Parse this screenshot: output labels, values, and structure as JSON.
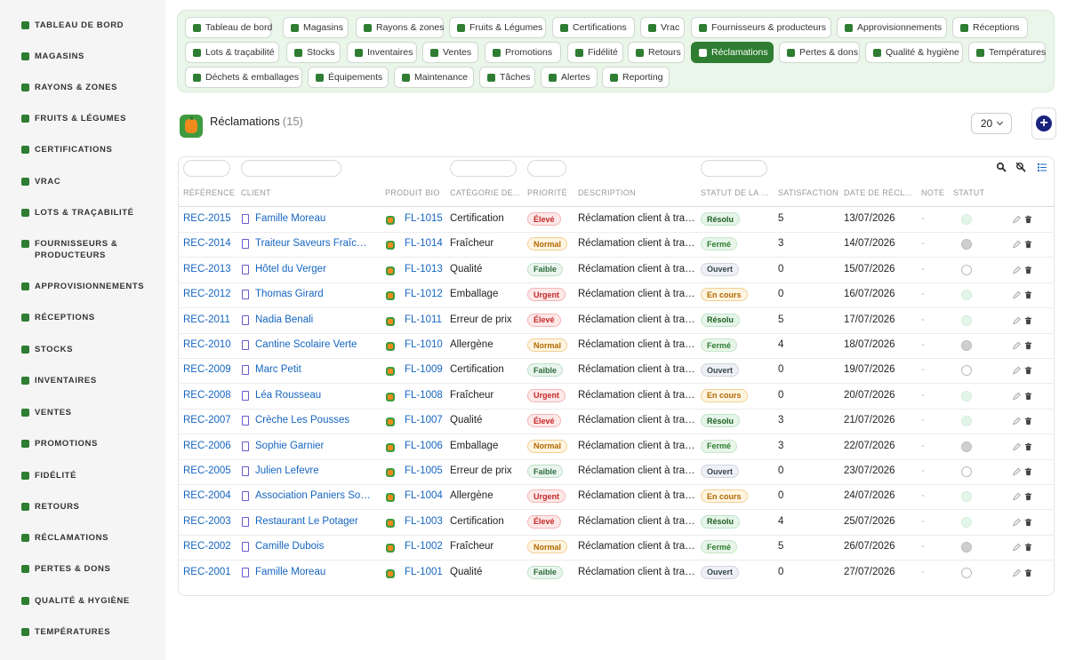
{
  "sidebar": {
    "items": [
      {
        "label": "Tableau de bord",
        "icon": "seedling-icon"
      },
      {
        "label": "Magasins",
        "icon": "store-icon"
      },
      {
        "label": "Rayons & zones",
        "icon": "grid-icon"
      },
      {
        "label": "Fruits & Légumes",
        "icon": "leaf-icon"
      },
      {
        "label": "Certifications",
        "icon": "certificate-icon"
      },
      {
        "label": "Vrac",
        "icon": "boxes-icon"
      },
      {
        "label": "Lots & traçabilité",
        "icon": "barcode-icon"
      },
      {
        "label": "Fournisseurs & producteurs",
        "icon": "truck-icon"
      },
      {
        "label": "Approvisionnements",
        "icon": "supply-icon"
      },
      {
        "label": "Réceptions",
        "icon": "truck-loading-icon"
      },
      {
        "label": "Stocks",
        "icon": "warehouse-icon"
      },
      {
        "label": "Inventaires",
        "icon": "clipboard-check-icon"
      },
      {
        "label": "Ventes",
        "icon": "cash-register-icon"
      },
      {
        "label": "Promotions",
        "icon": "tag-icon"
      },
      {
        "label": "Fidélité",
        "icon": "award-icon"
      },
      {
        "label": "Retours",
        "icon": "undo-icon"
      },
      {
        "label": "Réclamations",
        "icon": "comment-icon"
      },
      {
        "label": "Pertes & dons",
        "icon": "trash-icon"
      },
      {
        "label": "Qualité & hygiène",
        "icon": "clipboard-icon"
      },
      {
        "label": "Températures",
        "icon": "thermometer-icon"
      }
    ]
  },
  "nav": {
    "chips": [
      {
        "label": "Tableau de bord",
        "icon": "seedling-icon"
      },
      {
        "label": "Magasins",
        "icon": "store-icon"
      },
      {
        "label": "Rayons & zones",
        "icon": "grid-icon"
      },
      {
        "label": "Fruits & Légumes",
        "icon": "leaf-icon"
      },
      {
        "label": "Certifications",
        "icon": "certificate-icon"
      },
      {
        "label": "Vrac",
        "icon": "boxes-icon"
      },
      {
        "label": "Fournisseurs & producteurs",
        "icon": "truck-icon"
      },
      {
        "label": "Approvisionnements",
        "icon": "supply-icon"
      },
      {
        "label": "Réceptions",
        "icon": "truck-loading-icon"
      },
      {
        "label": "Lots & traçabilité",
        "icon": "barcode-icon"
      },
      {
        "label": "Stocks",
        "icon": "warehouse-icon"
      },
      {
        "label": "Inventaires",
        "icon": "clipboard-check-icon"
      },
      {
        "label": "Ventes",
        "icon": "cash-register-icon"
      },
      {
        "label": "Promotions",
        "icon": "tag-icon"
      },
      {
        "label": "Fidélité",
        "icon": "award-icon"
      },
      {
        "label": "Retours",
        "icon": "undo-icon"
      },
      {
        "label": "Réclamations",
        "icon": "comment-icon",
        "active": true
      },
      {
        "label": "Pertes & dons",
        "icon": "trash-icon"
      },
      {
        "label": "Qualité & hygiène",
        "icon": "clipboard-icon"
      },
      {
        "label": "Températures",
        "icon": "thermometer-icon"
      },
      {
        "label": "Déchets & emballages",
        "icon": "recycle-icon"
      },
      {
        "label": "Équipements",
        "icon": "tools-icon"
      },
      {
        "label": "Maintenance",
        "icon": "wrench-icon"
      },
      {
        "label": "Tâches",
        "icon": "tasks-icon"
      },
      {
        "label": "Alertes",
        "icon": "bell-icon"
      },
      {
        "label": "Reporting",
        "icon": "chart-pie-icon"
      }
    ]
  },
  "header": {
    "title": "Réclamations",
    "count": "(15)",
    "page_size": "20"
  },
  "table": {
    "columns": [
      "Référence",
      "Client",
      "Produit bio",
      "Catégorie de...",
      "Priorité",
      "Description",
      "Statut de la ...",
      "Satisfaction",
      "Date de récl...",
      "Note",
      "Statut"
    ],
    "rows": [
      {
        "ref": "REC-2015",
        "client": "Famille Moreau",
        "product": "FL-1015",
        "category": "Certification",
        "priority": "Élevé",
        "description": "Réclamation client à traiter.",
        "status": "Résolu",
        "satisfaction": "5",
        "date": "13/07/2026",
        "note": "-"
      },
      {
        "ref": "REC-2014",
        "client": "Traiteur Saveurs Fraîches",
        "product": "FL-1014",
        "category": "Fraîcheur",
        "priority": "Normal",
        "description": "Réclamation client à traiter.",
        "status": "Fermé",
        "satisfaction": "3",
        "date": "14/07/2026",
        "note": "-"
      },
      {
        "ref": "REC-2013",
        "client": "Hôtel du Verger",
        "product": "FL-1013",
        "category": "Qualité",
        "priority": "Faible",
        "description": "Réclamation client à traiter.",
        "status": "Ouvert",
        "satisfaction": "0",
        "date": "15/07/2026",
        "note": "-"
      },
      {
        "ref": "REC-2012",
        "client": "Thomas Girard",
        "product": "FL-1012",
        "category": "Emballage",
        "priority": "Urgent",
        "description": "Réclamation client à traiter.",
        "status": "En cours",
        "satisfaction": "0",
        "date": "16/07/2026",
        "note": "-"
      },
      {
        "ref": "REC-2011",
        "client": "Nadia Benali",
        "product": "FL-1011",
        "category": "Erreur de prix",
        "priority": "Élevé",
        "description": "Réclamation client à traiter.",
        "status": "Résolu",
        "satisfaction": "5",
        "date": "17/07/2026",
        "note": "-"
      },
      {
        "ref": "REC-2010",
        "client": "Cantine Scolaire Verte",
        "product": "FL-1010",
        "category": "Allergène",
        "priority": "Normal",
        "description": "Réclamation client à traiter.",
        "status": "Fermé",
        "satisfaction": "4",
        "date": "18/07/2026",
        "note": "-"
      },
      {
        "ref": "REC-2009",
        "client": "Marc Petit",
        "product": "FL-1009",
        "category": "Certification",
        "priority": "Faible",
        "description": "Réclamation client à traiter.",
        "status": "Ouvert",
        "satisfaction": "0",
        "date": "19/07/2026",
        "note": "-"
      },
      {
        "ref": "REC-2008",
        "client": "Léa Rousseau",
        "product": "FL-1008",
        "category": "Fraîcheur",
        "priority": "Urgent",
        "description": "Réclamation client à traiter.",
        "status": "En cours",
        "satisfaction": "0",
        "date": "20/07/2026",
        "note": "-"
      },
      {
        "ref": "REC-2007",
        "client": "Crèche Les Pousses",
        "product": "FL-1007",
        "category": "Qualité",
        "priority": "Élevé",
        "description": "Réclamation client à traiter.",
        "status": "Résolu",
        "satisfaction": "3",
        "date": "21/07/2026",
        "note": "-"
      },
      {
        "ref": "REC-2006",
        "client": "Sophie Garnier",
        "product": "FL-1006",
        "category": "Emballage",
        "priority": "Normal",
        "description": "Réclamation client à traiter.",
        "status": "Fermé",
        "satisfaction": "3",
        "date": "22/07/2026",
        "note": "-"
      },
      {
        "ref": "REC-2005",
        "client": "Julien Lefevre",
        "product": "FL-1005",
        "category": "Erreur de prix",
        "priority": "Faible",
        "description": "Réclamation client à traiter.",
        "status": "Ouvert",
        "satisfaction": "0",
        "date": "23/07/2026",
        "note": "-"
      },
      {
        "ref": "REC-2004",
        "client": "Association Paniers Solid...",
        "product": "FL-1004",
        "category": "Allergène",
        "priority": "Urgent",
        "description": "Réclamation client à traiter.",
        "status": "En cours",
        "satisfaction": "0",
        "date": "24/07/2026",
        "note": "-"
      },
      {
        "ref": "REC-2003",
        "client": "Restaurant Le Potager",
        "product": "FL-1003",
        "category": "Certification",
        "priority": "Élevé",
        "description": "Réclamation client à traiter.",
        "status": "Résolu",
        "satisfaction": "4",
        "date": "25/07/2026",
        "note": "-"
      },
      {
        "ref": "REC-2002",
        "client": "Camille Dubois",
        "product": "FL-1002",
        "category": "Fraîcheur",
        "priority": "Normal",
        "description": "Réclamation client à traiter.",
        "status": "Fermé",
        "satisfaction": "5",
        "date": "26/07/2026",
        "note": "-"
      },
      {
        "ref": "REC-2001",
        "client": "Famille Moreau",
        "product": "FL-1001",
        "category": "Qualité",
        "priority": "Faible",
        "description": "Réclamation client à traiter.",
        "status": "Ouvert",
        "satisfaction": "0",
        "date": "27/07/2026",
        "note": "-"
      }
    ]
  },
  "colors": {
    "accent": "#2e7d32",
    "link": "#1565c0",
    "priority": {
      "Élevé": {
        "bg": "#fde8e8",
        "fg": "#c62828",
        "border": "#f5b5b5"
      },
      "Normal": {
        "bg": "#fff4e0",
        "fg": "#b26a00",
        "border": "#f2cf94"
      },
      "Faible": {
        "bg": "#e9f5ee",
        "fg": "#2e6b3d",
        "border": "#bfe0c9"
      },
      "Urgent": {
        "bg": "#fde8e8",
        "fg": "#c62828",
        "border": "#f5b5b5"
      }
    },
    "status": {
      "Résolu": {
        "bg": "#e6f5ea",
        "fg": "#1b5e20",
        "border": "#bfe3c7"
      },
      "Fermé": {
        "bg": "#e8f5e9",
        "fg": "#2e7d32",
        "border": "#c8e6c9"
      },
      "Ouvert": {
        "bg": "#eef0f5",
        "fg": "#37474f",
        "border": "#cfd5e0"
      },
      "En cours": {
        "bg": "#fff4e0",
        "fg": "#b26a00",
        "border": "#f2cf94"
      }
    },
    "state_dot": {
      "Résolu": "#e3f5e8",
      "Fermé": "#cfcfcf",
      "Ouvert": "#ffffff",
      "En cours": "#e3f5e8"
    }
  }
}
